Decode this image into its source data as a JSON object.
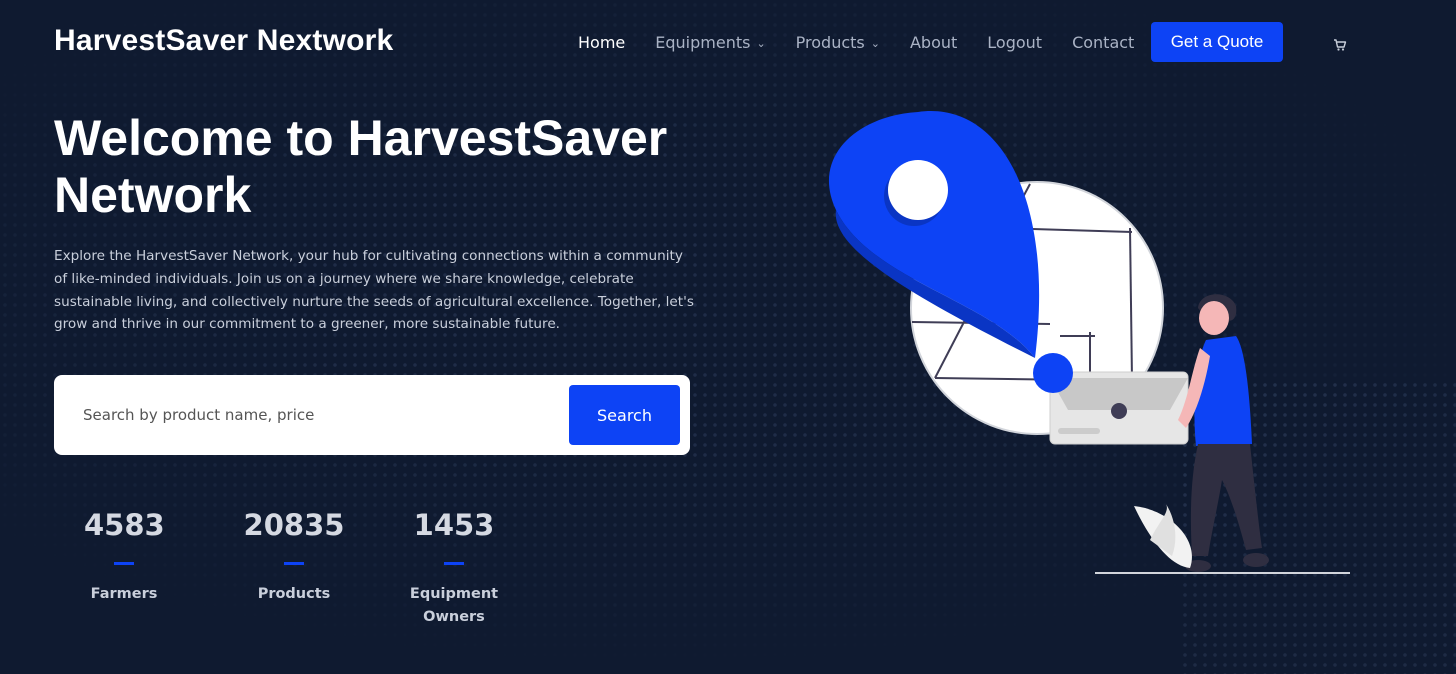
{
  "brand": {
    "name": "HarvestSaver Nextwork"
  },
  "nav": {
    "items": [
      {
        "label": "Home",
        "active": true,
        "dropdown": false
      },
      {
        "label": "Equipments",
        "active": false,
        "dropdown": true
      },
      {
        "label": "Products",
        "active": false,
        "dropdown": true
      },
      {
        "label": "About",
        "active": false,
        "dropdown": false
      },
      {
        "label": "Logout",
        "active": false,
        "dropdown": false
      },
      {
        "label": "Contact",
        "active": false,
        "dropdown": false
      }
    ],
    "quote_button": "Get a Quote",
    "cart_icon": "cart-icon"
  },
  "hero": {
    "title": "Welcome to HarvestSaver Network",
    "description": "Explore the HarvestSaver Network, your hub for cultivating connections within a community of like-minded individuals. Join us on a journey where we share knowledge, celebrate sustainable living, and collectively nurture the seeds of agricultural excellence. Together, let's grow and thrive in our commitment to a greener, more sustainable future."
  },
  "search": {
    "placeholder": "Search by product name, price",
    "value": "",
    "button": "Search"
  },
  "stats": [
    {
      "value": "4583",
      "label": "Farmers"
    },
    {
      "value": "20835",
      "label": "Products"
    },
    {
      "value": "1453",
      "label": "Equipment Owners"
    }
  ],
  "colors": {
    "background": "#0f1a30",
    "accent": "#0d43f5",
    "text_muted": "#aab3c5"
  }
}
